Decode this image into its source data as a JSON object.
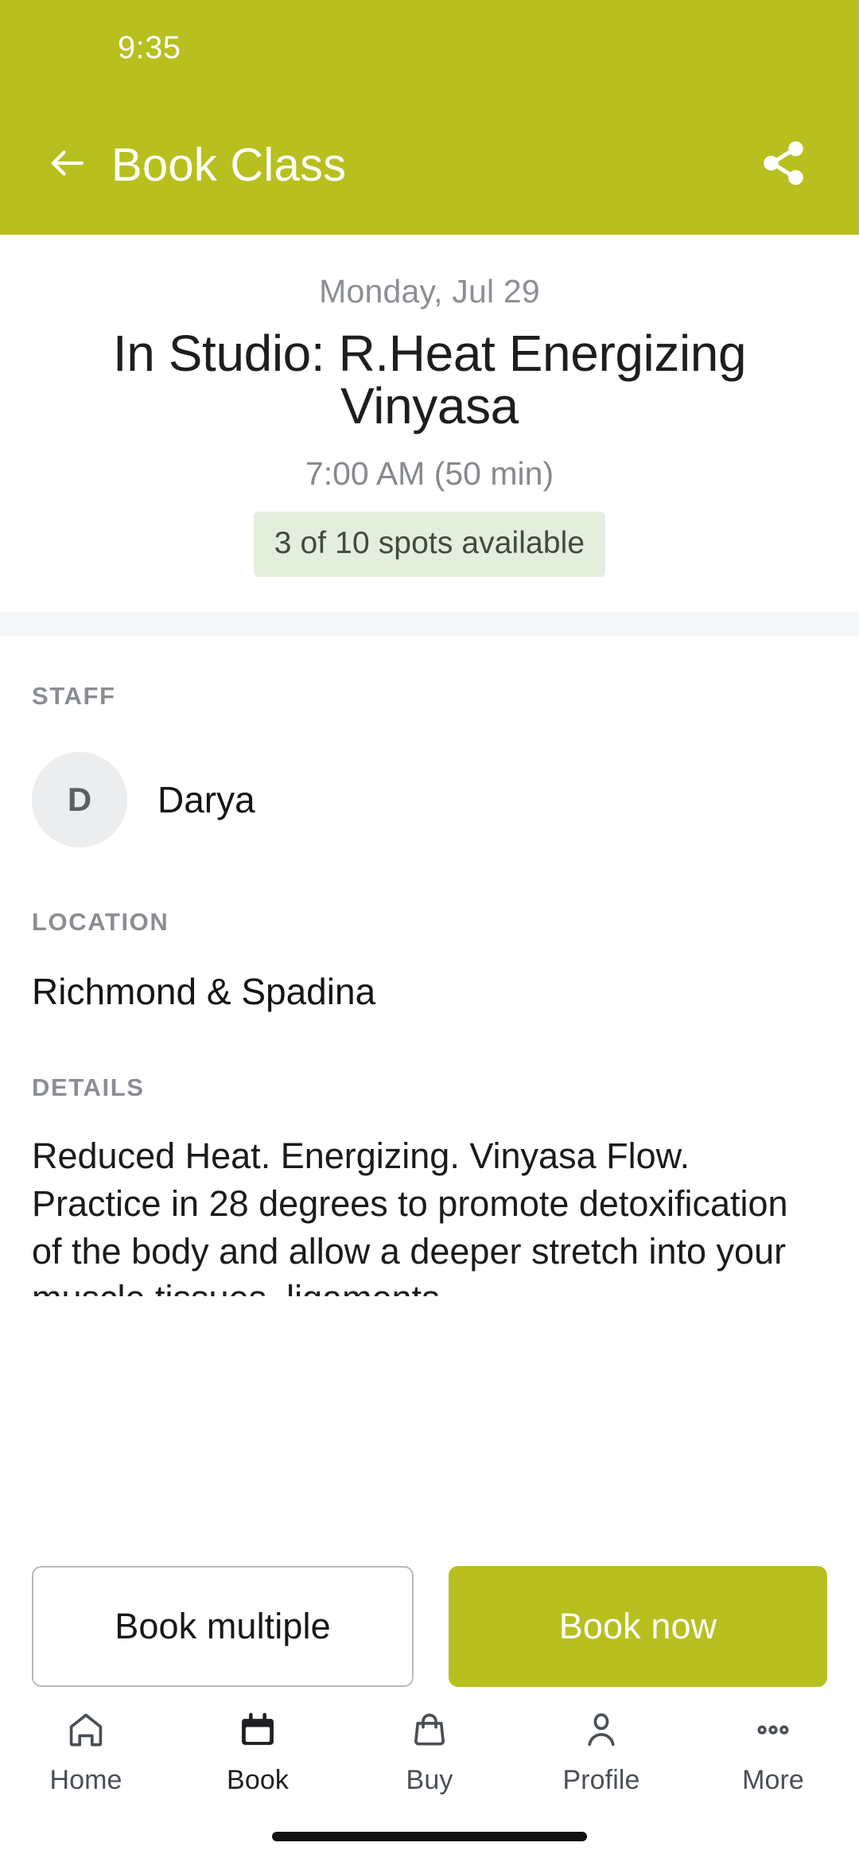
{
  "status_bar": {
    "time": "9:35"
  },
  "app_bar": {
    "title": "Book Class",
    "back_icon": "arrow-left-icon",
    "share_icon": "share-icon",
    "background_color": "#b7c01e"
  },
  "hero": {
    "date": "Monday, Jul 29",
    "title": "In Studio: R.Heat Energizing Vinyasa",
    "time": "7:00 AM (50 min)",
    "spots_badge": "3 of 10 spots available",
    "spots_badge_bg": "#e3efdd"
  },
  "sections": {
    "staff": {
      "label": "STAFF",
      "avatar_initial": "D",
      "name": "Darya"
    },
    "location": {
      "label": "LOCATION",
      "value": "Richmond & Spadina"
    },
    "details": {
      "label": "DETAILS",
      "text": "Reduced Heat. Energizing. Vinyasa Flow. Practice in 28 degrees to promote detoxification of the body and allow a deeper stretch into your muscle tissues, ligaments"
    }
  },
  "actions": {
    "secondary_label": "Book multiple",
    "primary_label": "Book now",
    "primary_color": "#b7c01e"
  },
  "bottom_nav": {
    "items": [
      {
        "label": "Home",
        "icon": "home-icon",
        "active": false
      },
      {
        "label": "Book",
        "icon": "calendar-icon",
        "active": true
      },
      {
        "label": "Buy",
        "icon": "bag-icon",
        "active": false
      },
      {
        "label": "Profile",
        "icon": "person-icon",
        "active": false
      },
      {
        "label": "More",
        "icon": "ellipsis-icon",
        "active": false
      }
    ]
  }
}
